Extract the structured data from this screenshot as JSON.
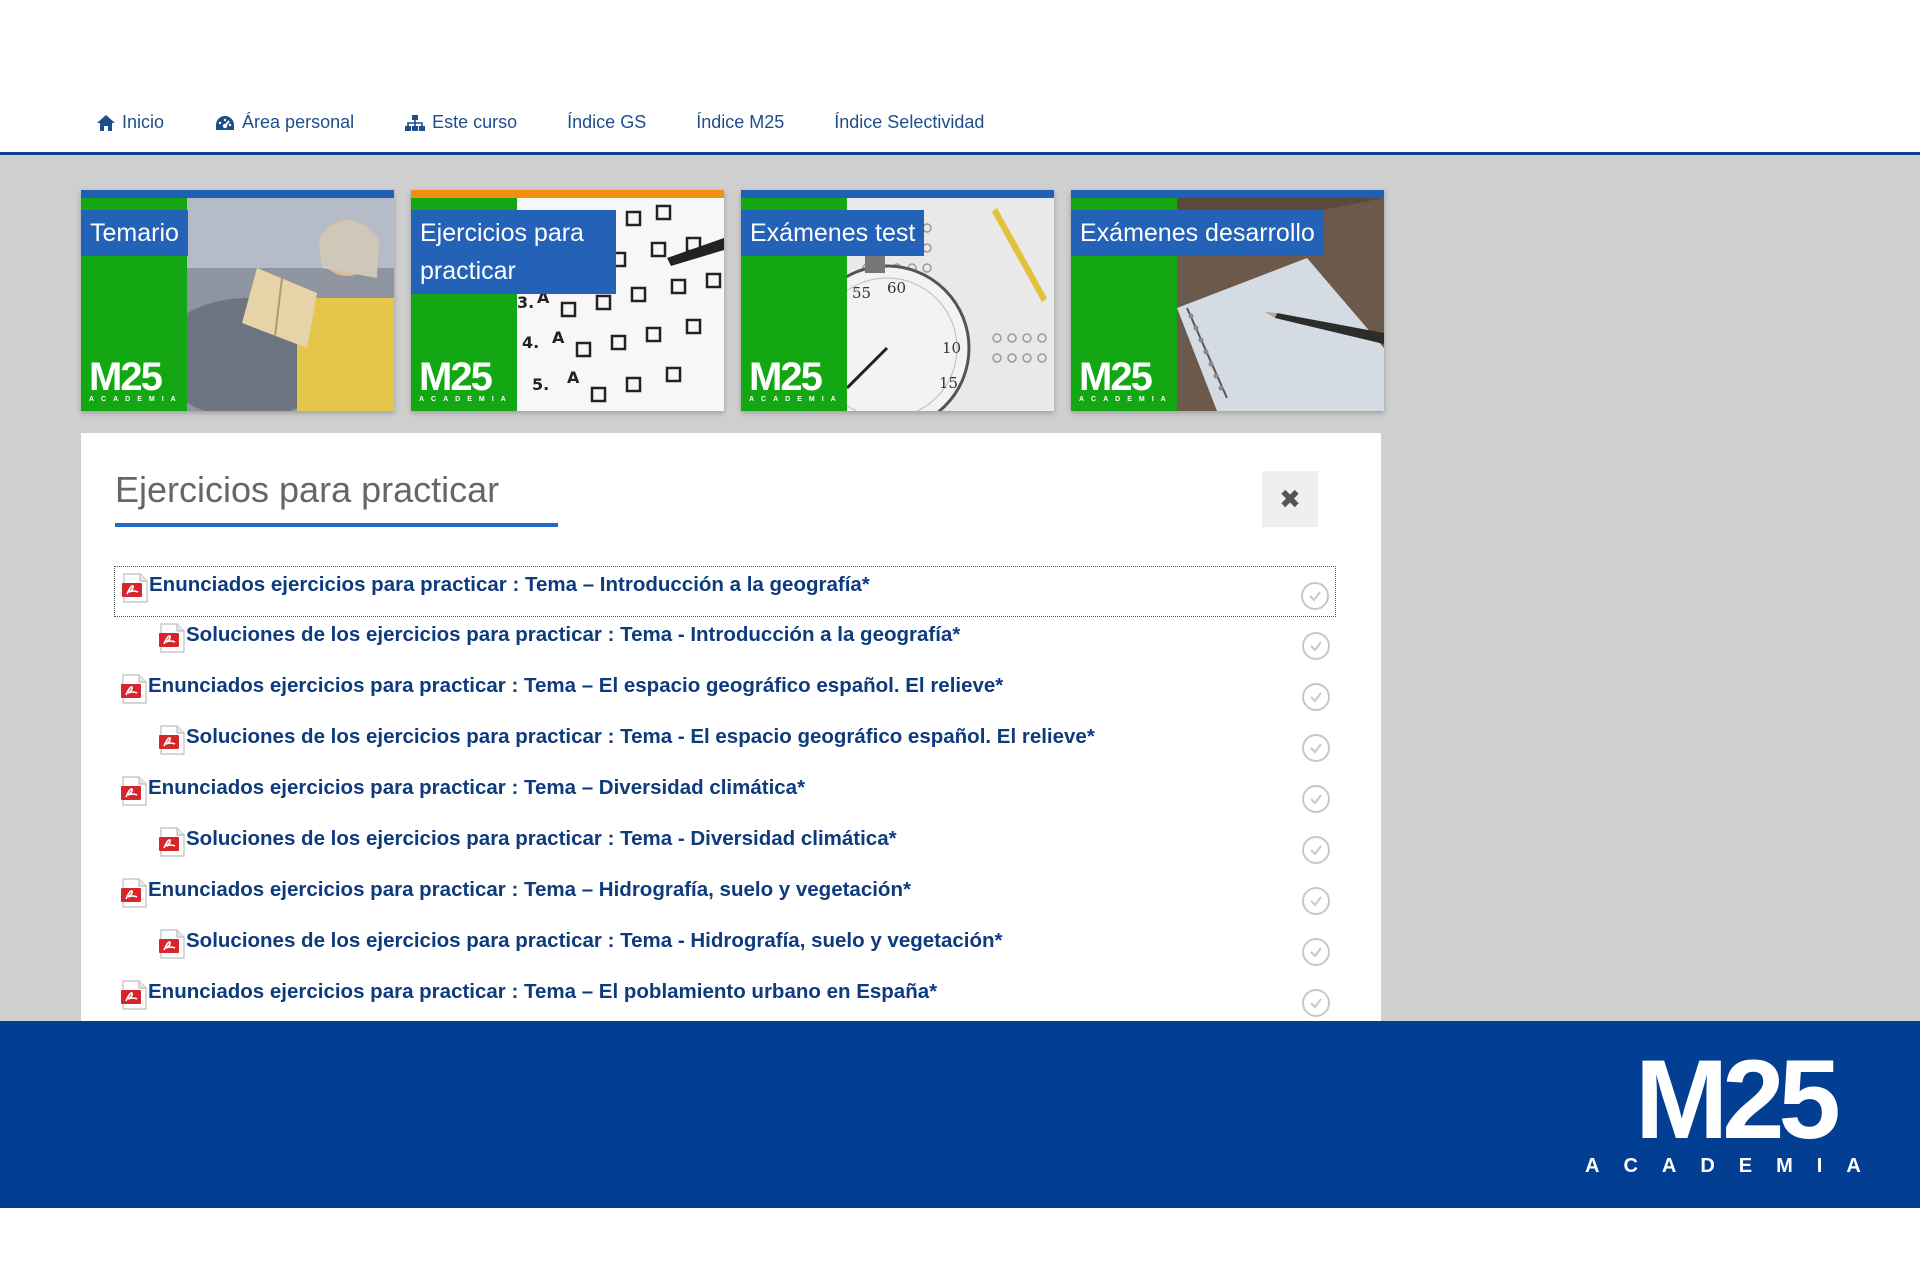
{
  "nav": {
    "items": [
      {
        "label": "Inicio",
        "icon": "home-icon"
      },
      {
        "label": "Área personal",
        "icon": "dashboard-icon"
      },
      {
        "label": "Este curso",
        "icon": "sitemap-icon"
      },
      {
        "label": "Índice GS"
      },
      {
        "label": "Índice M25"
      },
      {
        "label": "Índice Selectividad"
      }
    ]
  },
  "tiles": [
    {
      "label": "Temario",
      "logo": "M25",
      "logo_sub": "ACADEMIA"
    },
    {
      "label": "Ejercicios para practicar",
      "logo": "M25",
      "logo_sub": "ACADEMIA"
    },
    {
      "label": "Exámenes test",
      "logo": "M25",
      "logo_sub": "ACADEMIA"
    },
    {
      "label": "Exámenes desarrollo",
      "logo": "M25",
      "logo_sub": "ACADEMIA"
    }
  ],
  "panel": {
    "title": "Ejercicios para practicar",
    "close_label": "✖",
    "items": [
      {
        "text": "Enunciados ejercicios para practicar : Tema – Introducción a la geografía*",
        "level": 1
      },
      {
        "text": "Soluciones de los ejercicios para practicar : Tema - Introducción a la geografía*",
        "level": 2
      },
      {
        "text": "Enunciados ejercicios para practicar : Tema – El espacio geográfico español. El relieve*",
        "level": 1
      },
      {
        "text": "Soluciones de los ejercicios para practicar : Tema - El espacio geográfico español. El relieve*",
        "level": 2
      },
      {
        "text": "Enunciados ejercicios para practicar : Tema – Diversidad climática*",
        "level": 1
      },
      {
        "text": "Soluciones de los ejercicios para practicar : Tema - Diversidad climática*",
        "level": 2
      },
      {
        "text": "Enunciados ejercicios para practicar : Tema – Hidrografía, suelo y vegetación*",
        "level": 1
      },
      {
        "text": "Soluciones de los ejercicios para practicar : Tema - Hidrografía, suelo y vegetación*",
        "level": 2
      },
      {
        "text": "Enunciados ejercicios para practicar : Tema – El poblamiento urbano en España*",
        "level": 1
      }
    ]
  },
  "footer": {
    "logo": "M25",
    "logo_sub": "ACADEMIA"
  },
  "colors": {
    "brand_blue": "#023f92",
    "link": "#0e3a7e",
    "tile_green": "#13a813",
    "tile_label": "#2462b8",
    "active_bar": "#f29111"
  }
}
